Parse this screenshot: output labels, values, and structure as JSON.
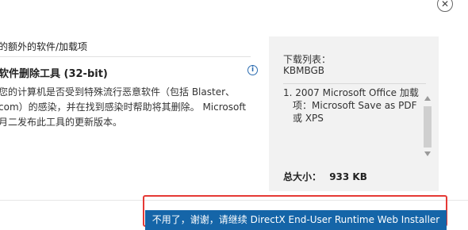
{
  "window": {
    "close_glyph": "✕"
  },
  "left": {
    "section_text": "的额外的软件/加载项",
    "product_title": "软件删除工具 (32-bit)",
    "info_glyph": "i",
    "desc_lines": [
      "您的计算机是否受到特殊流行恶意软件（包括 Blaster、",
      "com）的感染，并在找到感染时帮助将其删除。 Microsoft",
      "月二发布此工具的更新版本。"
    ]
  },
  "download_panel": {
    "label": "下载列表：",
    "code": "KBMBGB",
    "item_lines": [
      "1. 2007 Microsoft Office 加载",
      "   项：Microsoft Save as PDF",
      "   或 XPS"
    ],
    "total_label": "总大小：",
    "total_value": "933 KB"
  },
  "footer": {
    "continue_label": "不用了，谢谢，请继续 DirectX End-User Runtime Web Installer",
    "highlight_color": "#e53935",
    "button_color": "#1565a8"
  }
}
